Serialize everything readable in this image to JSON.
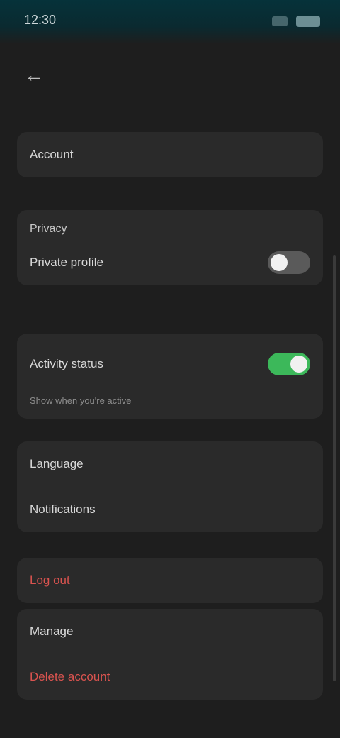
{
  "status_bar": {
    "time": "12:30"
  },
  "nav": {
    "back_icon": "arrow-left-icon",
    "back_glyph": "←"
  },
  "account": {
    "label": "Account"
  },
  "privacy": {
    "title": "Privacy",
    "private_profile_label": "Private profile",
    "private_profile_on": false,
    "activity_status_label": "Activity status",
    "activity_status_on": true,
    "activity_status_desc": "Show when you're active"
  },
  "general": {
    "language_label": "Language",
    "notifications_label": "Notifications"
  },
  "danger": {
    "logout_label": "Log out",
    "manage_label": "Manage",
    "delete_label": "Delete account"
  },
  "colors": {
    "accent_on": "#3cb85a",
    "danger": "#d9534f"
  }
}
